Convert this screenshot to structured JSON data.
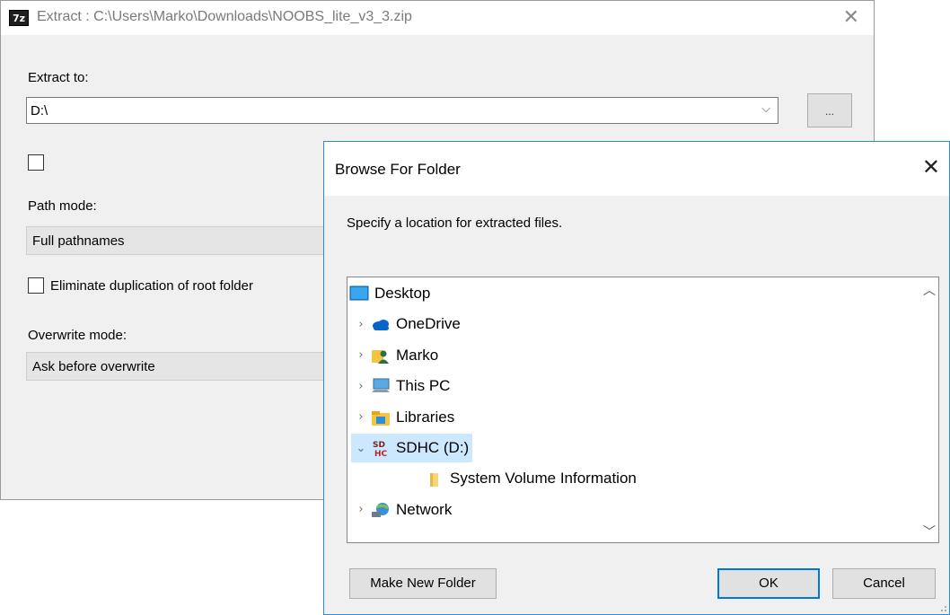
{
  "extract_window": {
    "app_icon": "7z",
    "title": "Extract : C:\\Users\\Marko\\Downloads\\NOOBS_lite_v3_3.zip",
    "extract_to_label": "Extract to:",
    "path_value": "D:\\",
    "browse_button": "...",
    "path_mode_label": "Path mode:",
    "path_mode_value": "Full pathnames",
    "eliminate_label": "Eliminate duplication of root folder",
    "overwrite_label": "Overwrite mode:",
    "overwrite_value": "Ask before overwrite"
  },
  "browse_dialog": {
    "title": "Browse For Folder",
    "instruction": "Specify a location for extracted files.",
    "tree": [
      {
        "label": "Desktop",
        "icon": "desktop-icon",
        "expander": "",
        "indent": 0,
        "selected": false
      },
      {
        "label": "OneDrive",
        "icon": "onedrive-icon",
        "expander": ">",
        "indent": 1,
        "selected": false
      },
      {
        "label": "Marko",
        "icon": "user-folder-icon",
        "expander": ">",
        "indent": 1,
        "selected": false
      },
      {
        "label": "This PC",
        "icon": "this-pc-icon",
        "expander": ">",
        "indent": 1,
        "selected": false
      },
      {
        "label": "Libraries",
        "icon": "libraries-icon",
        "expander": ">",
        "indent": 1,
        "selected": false
      },
      {
        "label": "SDHC (D:)",
        "icon": "sdhc-drive-icon",
        "expander": "v",
        "indent": 1,
        "selected": true
      },
      {
        "label": "System Volume Information",
        "icon": "folder-icon",
        "expander": "",
        "indent": 2,
        "selected": false
      },
      {
        "label": "Network",
        "icon": "network-icon",
        "expander": ">",
        "indent": 1,
        "selected": false
      }
    ],
    "buttons": {
      "make_new_folder": "Make New Folder",
      "ok": "OK",
      "cancel": "Cancel"
    }
  },
  "colors": {
    "dialog_border": "#2b8ad9",
    "selection": "#cce8ff",
    "default_button_border": "#0078d7"
  }
}
